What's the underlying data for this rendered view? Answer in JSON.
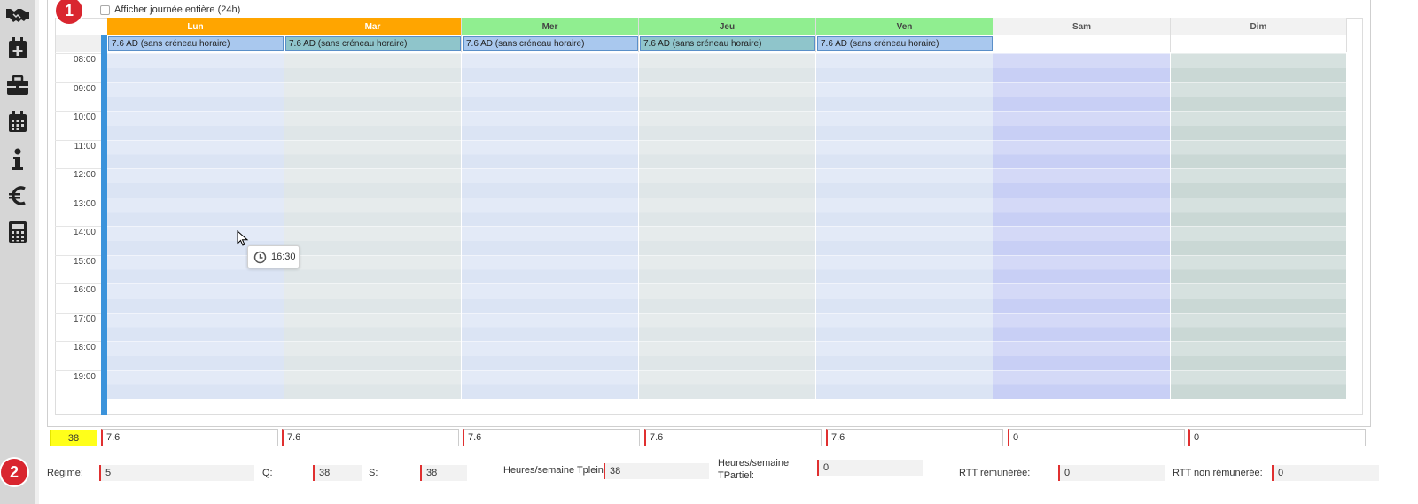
{
  "badges": {
    "one": "1",
    "two": "2"
  },
  "allday_checkbox": {
    "label": "Afficher journée entière (24h)",
    "checked": false
  },
  "days": [
    {
      "label": "Lun",
      "color": "#ffa500",
      "text": "#ffffff",
      "event": "7.6 AD (sans créneau horaire)",
      "event_bg": "#a9c8ee",
      "total": "7.6"
    },
    {
      "label": "Mar",
      "color": "#ffa500",
      "text": "#ffffff",
      "event": "7.6 AD (sans créneau horaire)",
      "event_bg": "#8fc5cb",
      "total": "7.6"
    },
    {
      "label": "Mer",
      "color": "#90ee90",
      "text": "#444444",
      "event": "7.6 AD (sans créneau horaire)",
      "event_bg": "#a9c8ee",
      "total": "7.6"
    },
    {
      "label": "Jeu",
      "color": "#90ee90",
      "text": "#444444",
      "event": "7.6 AD (sans créneau horaire)",
      "event_bg": "#8fc5cb",
      "total": "7.6"
    },
    {
      "label": "Ven",
      "color": "#90ee90",
      "text": "#444444",
      "event": "7.6 AD (sans créneau horaire)",
      "event_bg": "#a9c8ee",
      "total": "7.6"
    },
    {
      "label": "Sam",
      "color": "#f2f2f2",
      "text": "#555555",
      "event": "",
      "event_bg": "",
      "total": "0"
    },
    {
      "label": "Dim",
      "color": "#f2f2f2",
      "text": "#555555",
      "event": "",
      "event_bg": "",
      "total": "0"
    }
  ],
  "times": [
    "08:00",
    "09:00",
    "10:00",
    "11:00",
    "12:00",
    "13:00",
    "14:00",
    "15:00",
    "16:00",
    "17:00",
    "18:00",
    "19:00"
  ],
  "tooltip": {
    "time": "16:30",
    "icon": "clock-icon"
  },
  "week_total": "38",
  "form": {
    "regime_label": "Régime:",
    "regime_value": "5",
    "q_label": "Q:",
    "q_value": "38",
    "s_label": "S:",
    "s_value": "38",
    "tplein_label": "Heures/semaine Tplein:",
    "tplein_value": "38",
    "tpartiel_label_1": "Heures/semaine",
    "tpartiel_label_2": "TPartiel:",
    "tpartiel_value": "0",
    "rtt_label": "RTT rémunérée:",
    "rtt_value": "0",
    "rtt_non_label": "RTT non rémunérée:",
    "rtt_non_value": "0"
  },
  "sidebar_icons": [
    "handshake-icon",
    "calendar-add-icon",
    "briefcase-icon",
    "calendar-icon",
    "info-icon",
    "euro-icon",
    "calculator-icon"
  ],
  "colors": {
    "accent_blue": "#3b93db",
    "badge_red": "#d9262f",
    "total_yellow": "#ffff1a"
  }
}
